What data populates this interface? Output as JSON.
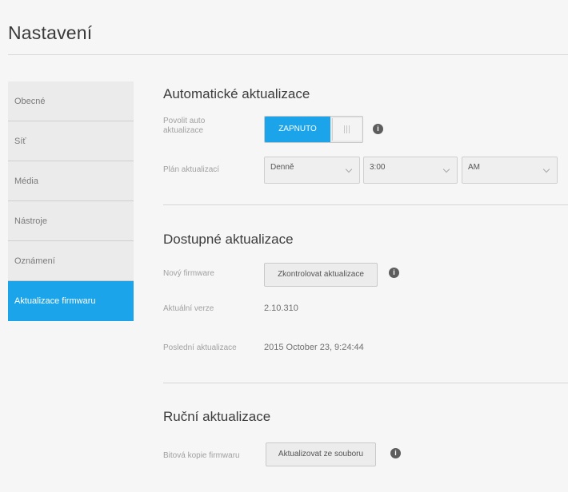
{
  "page": {
    "title": "Nastavení"
  },
  "sidebar": {
    "items": [
      {
        "label": "Obecné"
      },
      {
        "label": "Síť"
      },
      {
        "label": "Média"
      },
      {
        "label": "Nástroje"
      },
      {
        "label": "Oznámení"
      },
      {
        "label": "Aktualizace firmwaru",
        "active": true
      }
    ]
  },
  "auto_updates": {
    "title": "Automatické aktualizace",
    "allow_label": "Povolit auto aktualizace",
    "toggle_state": "ZAPNUTO",
    "schedule_label": "Plán aktualizací",
    "frequency": "Denně",
    "time": "3:00",
    "ampm": "AM"
  },
  "available_updates": {
    "title": "Dostupné aktualizace",
    "firmware_label": "Nový firmware",
    "check_button": "Zkontrolovat aktualizace",
    "version_label": "Aktuální verze",
    "version_value": "2.10.310",
    "last_update_label": "Poslední aktualizace",
    "last_update_value": "2015 October 23, 9:24:44"
  },
  "manual_update": {
    "title": "Ruční aktualizace",
    "image_label": "Bitová kopie firmwaru",
    "upload_button": "Aktualizovat ze souboru"
  },
  "colors": {
    "accent": "#1ba4ea",
    "info_icon": "#5d5d5d"
  },
  "icons": {
    "info": "info-icon",
    "dropdown": "chevron-down-icon"
  }
}
